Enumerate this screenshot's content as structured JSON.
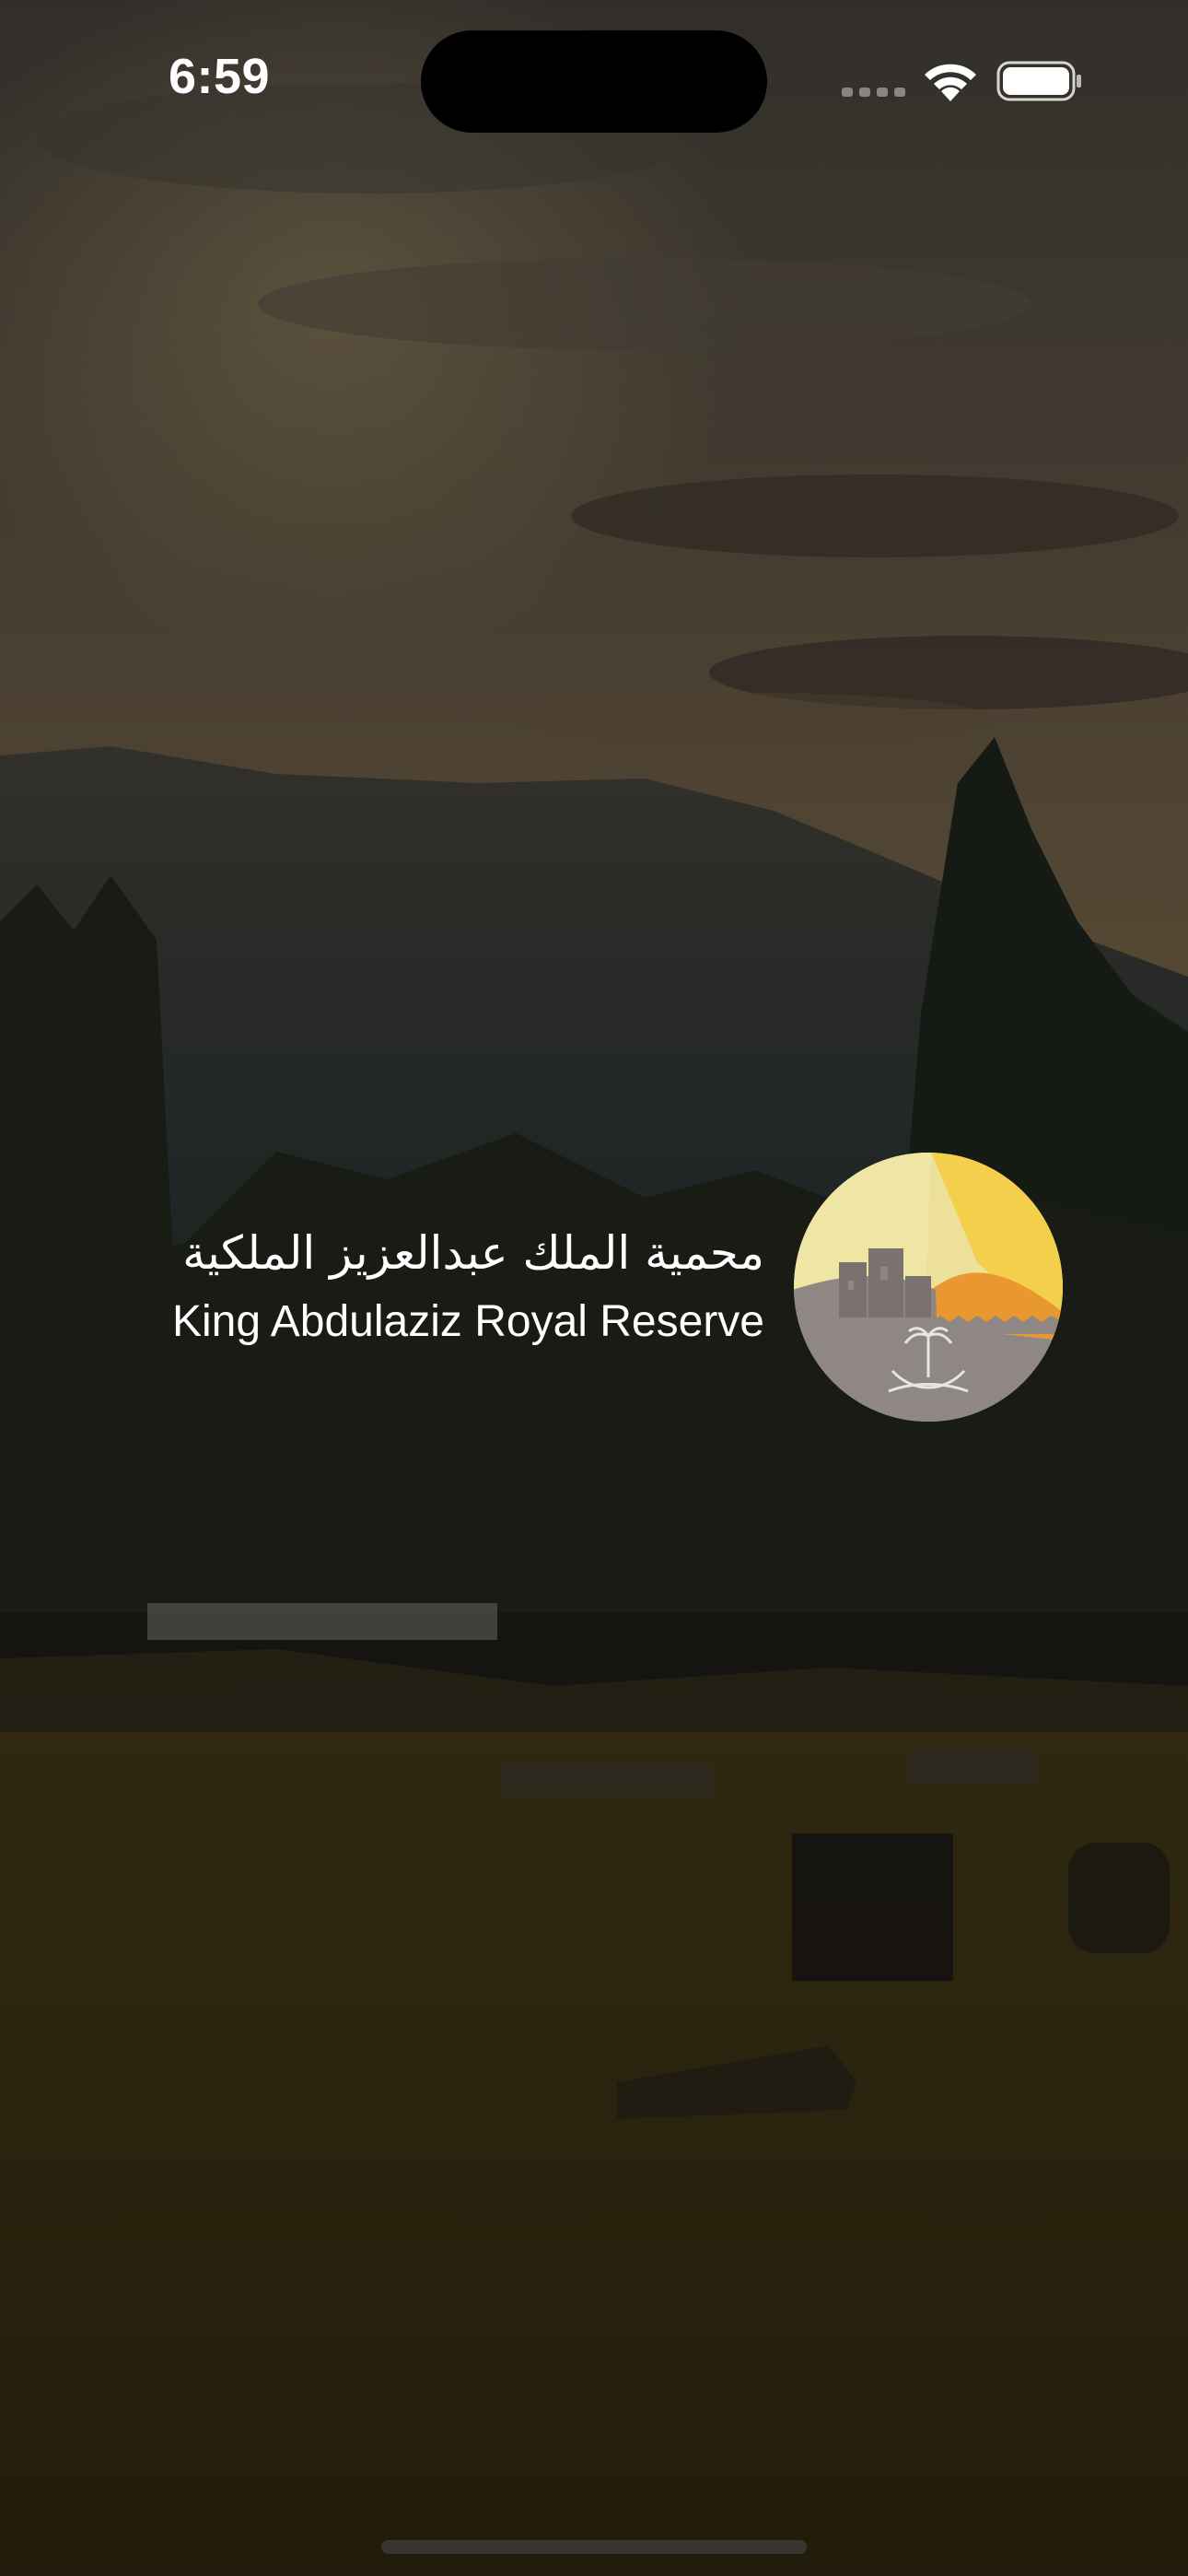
{
  "status_bar": {
    "time": "6:59"
  },
  "splash": {
    "title_ar": "محمية الملك عبدالعزيز الملكية",
    "title_en": "King Abdulaziz Royal Reserve"
  },
  "icons": {
    "signal": "cellular-signal-icon",
    "wifi": "wifi-icon",
    "battery": "battery-icon",
    "logo": "reserve-logo"
  },
  "colors": {
    "text": "#ffffff",
    "logo_yellow": "#f3cf4b",
    "logo_orange": "#e8982e",
    "logo_gray": "#8f8784"
  }
}
